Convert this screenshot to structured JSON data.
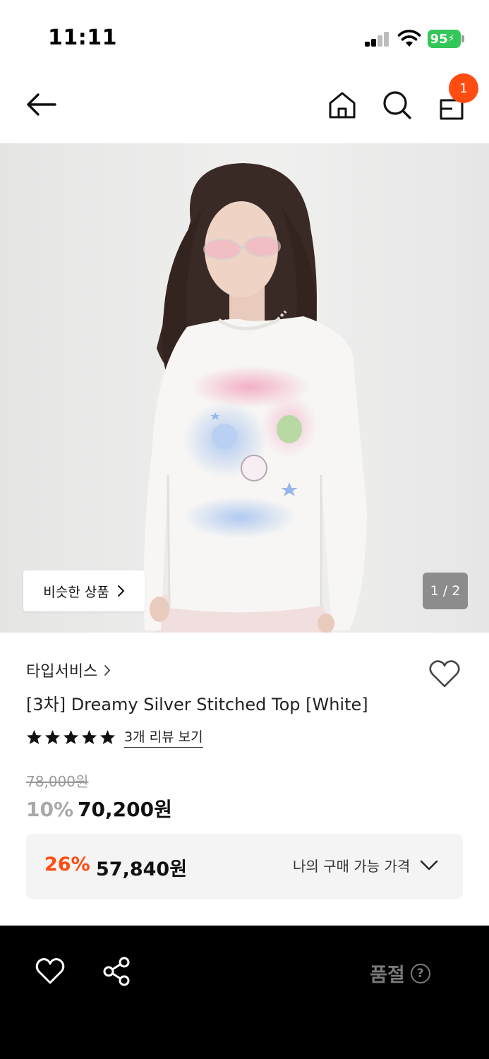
{
  "status_bar": {
    "time": "11:11",
    "battery_level": "95",
    "battery_color": "#33c759"
  },
  "nav": {
    "back_icon": "arrow-left-icon",
    "home_icon": "home-icon",
    "search_icon": "search-icon",
    "cart_icon": "shopping-bag-icon",
    "cart_count": "1",
    "badge_color": "#ff4d12"
  },
  "image": {
    "similar_button_label": "비슷한 상품",
    "page_indicator": "1 / 2"
  },
  "product": {
    "brand": "타입서비스",
    "title": "[3차] Dreamy Silver Stitched Top [White]",
    "rating_stars": 5,
    "review_link": "3개 리뷰 보기",
    "original_price": "78,000원",
    "discount_rate": "10%",
    "sale_price": "70,200원"
  },
  "benefit": {
    "rate": "26%",
    "price": "57,840원",
    "toggle_label": "나의 구매 가능 가격",
    "accent_color": "#ff4d12"
  },
  "bottom_bar": {
    "wishlist_icon": "heart-icon",
    "share_icon": "share-icon",
    "status_label": "품절",
    "help_glyph": "?"
  }
}
